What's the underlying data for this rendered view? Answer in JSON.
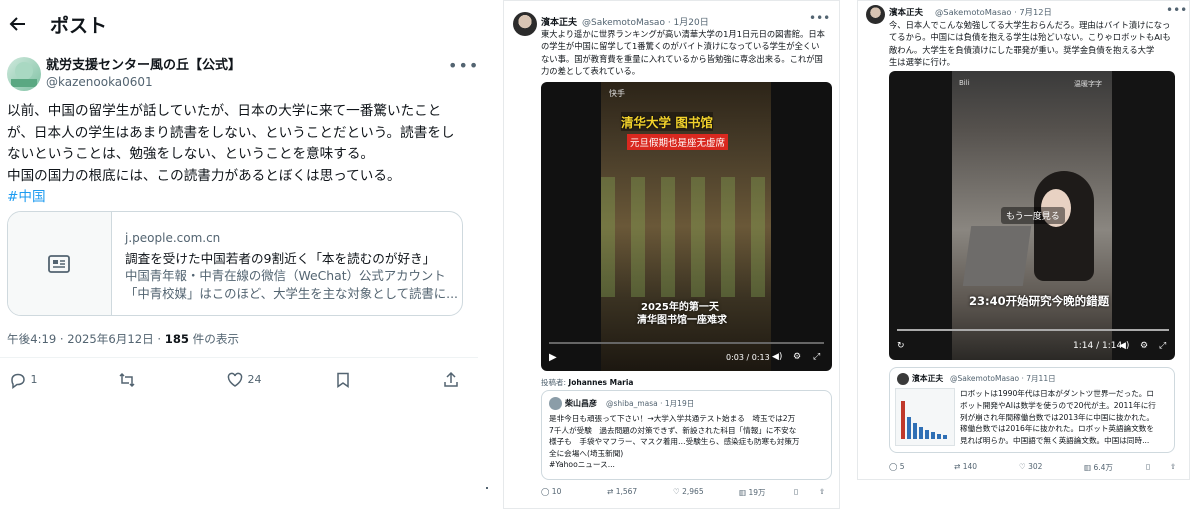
{
  "left_post": {
    "header_title": "ポスト",
    "author_name": "就労支援センター風の丘【公式】",
    "author_handle": "@kazenooka0601",
    "body_lines": [
      "以前、中国の留学生が話していたが、日本の大学に来て一番驚いたこと",
      "が、日本人の学生はあまり読書をしない、ということだという。読書をし",
      "ないということは、勉強をしない、ということを意味する。",
      "中国の国力の根底には、この読書力があるとぼくは思っている。"
    ],
    "hashtag": "#中国",
    "card": {
      "domain": "j.people.com.cn",
      "title": "調査を受けた中国若者の9割近く「本を読むのが好き」",
      "desc_lines": [
        "中国青年報・中青在線の微信（WeChat）公式アカウント",
        "「中青校媒」はこのほど、大学生を主な対象として読書に..."
      ]
    },
    "meta_time": "午後4:19 · 2025年6月12日 · ",
    "meta_views": "185",
    "meta_views_label": " 件の表示",
    "actions": {
      "reply": "1",
      "repost": "",
      "like": "24",
      "bookmark": "",
      "share": ""
    },
    "icons": [
      "back-arrow-icon",
      "more-icon",
      "news-card-icon",
      "reply-icon",
      "repost-icon",
      "like-icon",
      "bookmark-icon",
      "share-icon"
    ]
  },
  "mid_post": {
    "author_name": "濱本正夫",
    "author_handle": "@SakemotoMasao · 1月20日",
    "body_lines": [
      "東大より遥かに世界ランキングが高い清華大学の1月1日元日の図書館。日本",
      "の学生が中国に留学して1番驚くのがバイト漬けになっている学生が全くい",
      "ない事。国が教育費を重量に入れているから皆勉強に専念出来る。これが国",
      "力の差として表れている。"
    ],
    "video": {
      "watermark": "快手",
      "title_yellow": "清华大学 图书馆",
      "title_red": "元旦假期也是座无虚席",
      "caption_1": "2025年的第一天",
      "caption_2": "清华图书馆一座难求",
      "time": "0:03 / 0:13"
    },
    "posted_by_label": "投稿者: ",
    "posted_by": "Johannes Maria",
    "quote": {
      "author_name": "柴山昌彦",
      "author_handle": "@shiba_masa · 1月19日",
      "lines": [
        "是非今日も頑張って下さい！→大学入学共通テスト始まる　埼玉では2万",
        "7千人が受験　過去問題の対策できず、新設された科目「情報」に不安な",
        "様子も　手袋やマフラー、マスク着用…受験生ら、感染症も防寒も対策万",
        "全に会場へ(埼玉新聞)",
        "#Yahooニュース..."
      ]
    },
    "actions": {
      "reply": "10",
      "repost": "1,567",
      "like": "2,965",
      "views": "19万"
    }
  },
  "right_post": {
    "author_name": "濱本正夫",
    "author_handle": "@SakemotoMasao · 7月12日",
    "body_lines": [
      "今、日本人でこんな勉強してる大学生おらんだろ。理由はバイト漬けになっ",
      "てるから。中国には負債を抱える学生は殆どいない。こりゃロボットもAIも",
      "敵わん。大学生を負債漬けにした罪発が重い。奨学金負債を抱える大学",
      "生は選挙に行け。"
    ],
    "video": {
      "watermark_left": "Bili",
      "watermark_right": "温暖字字",
      "bubble": "もう一度見る",
      "caption": "23:40开始研究今晚的錯题",
      "time": "1:14 / 1:14"
    },
    "quote": {
      "author_name": "濱本正夫",
      "author_handle": "@SakemotoMasao · 7月11日",
      "lines": [
        "ロボットは1990年代は日本がダントツ世界一だった。ロ",
        "ボット開発やAIは数学を使うので20代が主。2011年に行",
        "列が崩され年間稼働台数では2013年に中国に抜かれた。",
        "稼働台数では2016年に抜かれた。ロボット英語論文数を",
        "見れば明らか。中国語で無く英語論文数。中国は同時..."
      ]
    },
    "actions": {
      "reply": "5",
      "repost": "140",
      "like": "302",
      "views": "6.4万"
    }
  }
}
